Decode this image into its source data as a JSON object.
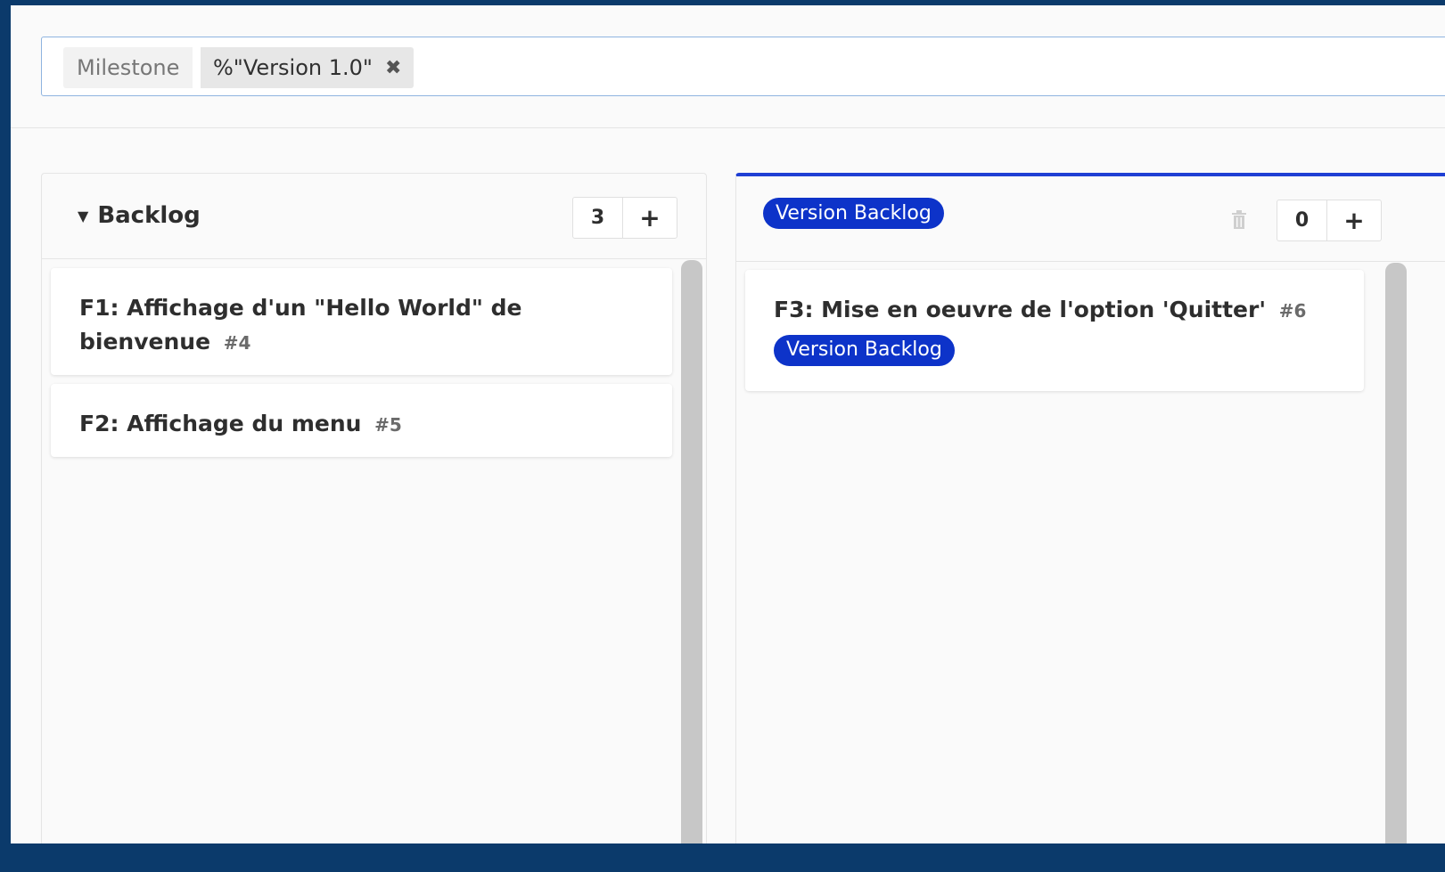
{
  "filter": {
    "token_name": "Milestone",
    "token_value": "%\"Version 1.0\""
  },
  "lists": {
    "backlog": {
      "title": "Backlog",
      "count": "3",
      "add_label": "+",
      "cards": [
        {
          "title": "F1: Affichage d'un \"Hello World\" de bienvenue",
          "number": "#4"
        },
        {
          "title": "F2: Affichage du menu",
          "number": "#5"
        }
      ]
    },
    "version_backlog": {
      "title": "Version Backlog",
      "count": "0",
      "add_label": "+",
      "label_color": "#0d33c9",
      "cards": [
        {
          "title": "F3: Mise en oeuvre de l'option 'Quitter'",
          "number": "#6",
          "label": "Version Backlog"
        }
      ]
    }
  }
}
